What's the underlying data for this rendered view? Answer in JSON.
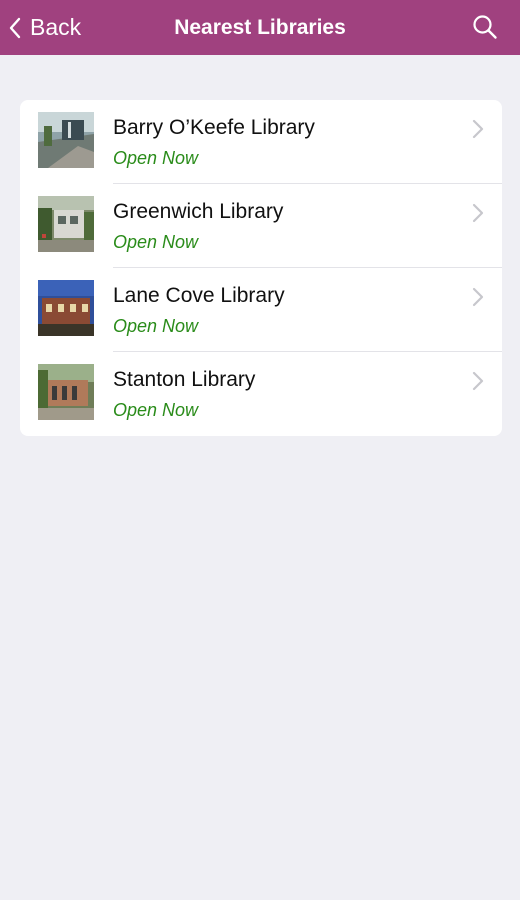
{
  "colors": {
    "accent": "#a0417f",
    "background": "#efeff4",
    "status_open": "#2a8c1a",
    "chevron": "#c7c7cc"
  },
  "nav": {
    "back_label": "Back",
    "title": "Nearest Libraries",
    "back_icon": "chevron-left-icon",
    "search_icon": "search-icon"
  },
  "libraries": [
    {
      "name": "Barry O’Keefe Library",
      "status": "Open Now"
    },
    {
      "name": "Greenwich Library",
      "status": "Open Now"
    },
    {
      "name": "Lane Cove Library",
      "status": "Open Now"
    },
    {
      "name": "Stanton Library",
      "status": "Open Now"
    }
  ]
}
